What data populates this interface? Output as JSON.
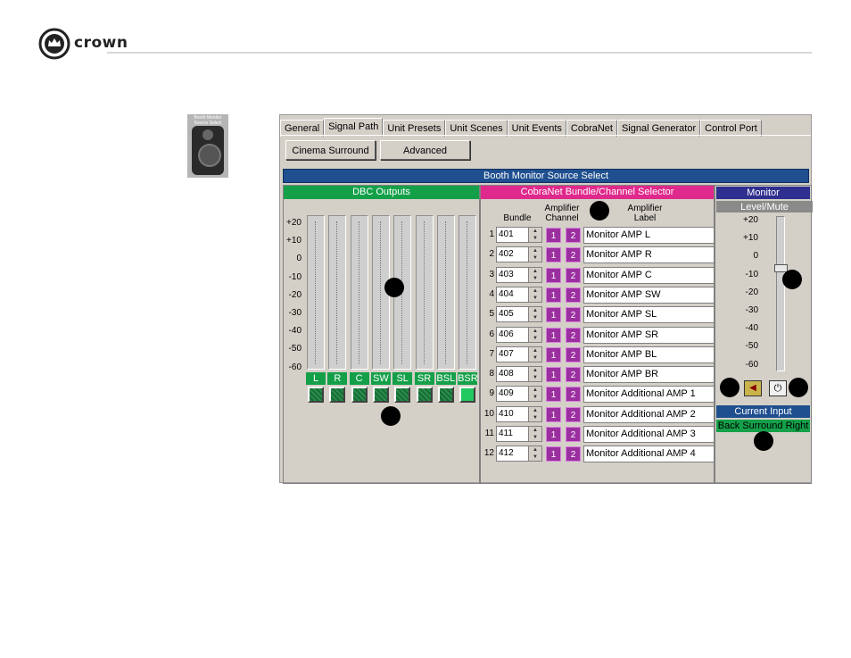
{
  "brand": {
    "name": "crown"
  },
  "thumbnail": {
    "caption": "Booth Monitor Source Select"
  },
  "tabs": [
    {
      "label": "General"
    },
    {
      "label": "Signal Path",
      "active": true
    },
    {
      "label": "Unit Presets"
    },
    {
      "label": "Unit Scenes"
    },
    {
      "label": "Unit Events"
    },
    {
      "label": "CobraNet"
    },
    {
      "label": "Signal Generator"
    },
    {
      "label": "Control Port"
    }
  ],
  "mode_buttons": {
    "cinema_surround": "Cinema Surround",
    "advanced": "Advanced"
  },
  "title_bar": "Booth Monitor Source Select",
  "dbc": {
    "title": "DBC Outputs",
    "scale": [
      "+20",
      "+10",
      "0",
      "-10",
      "-20",
      "-30",
      "-40",
      "-50",
      "-60"
    ],
    "channels": [
      "L",
      "R",
      "C",
      "SW",
      "SL",
      "SR",
      "BSL",
      "BSR"
    ],
    "selected_channel": "BSR"
  },
  "cobranet": {
    "title": "CobraNet Bundle/Channel Selector",
    "col_bundle": "Bundle",
    "col_channel": "Amplifier Channel",
    "col_label": "Amplifier Label",
    "rows": [
      {
        "n": "1",
        "bundle": "401",
        "label": "Monitor AMP L"
      },
      {
        "n": "2",
        "bundle": "402",
        "label": "Monitor AMP R"
      },
      {
        "n": "3",
        "bundle": "403",
        "label": "Monitor AMP C"
      },
      {
        "n": "4",
        "bundle": "404",
        "label": "Monitor AMP SW"
      },
      {
        "n": "5",
        "bundle": "405",
        "label": "Monitor AMP SL"
      },
      {
        "n": "6",
        "bundle": "406",
        "label": "Monitor AMP SR"
      },
      {
        "n": "7",
        "bundle": "407",
        "label": "Monitor AMP BL"
      },
      {
        "n": "8",
        "bundle": "408",
        "label": "Monitor AMP BR"
      },
      {
        "n": "9",
        "bundle": "409",
        "label": "Monitor Additional AMP 1"
      },
      {
        "n": "10",
        "bundle": "410",
        "label": "Monitor Additional AMP 2"
      },
      {
        "n": "11",
        "bundle": "411",
        "label": "Monitor Additional AMP 3"
      },
      {
        "n": "12",
        "bundle": "412",
        "label": "Monitor Additional AMP 4"
      }
    ],
    "ch1": "1",
    "ch2": "2"
  },
  "monitor": {
    "title": "Monitor",
    "level_mute": "Level/Mute",
    "scale": [
      "+20",
      "+10",
      "0",
      "-10",
      "-20",
      "-30",
      "-40",
      "-50",
      "-60"
    ],
    "level_db": -5,
    "current_input_title": "Current Input",
    "current_input_value": "Back Surround Right"
  },
  "colors": {
    "title_bar": "#1f4f8f",
    "dbc_header": "#14a049",
    "cobranet_header": "#e0298c",
    "monitor_header": "#2f2f8f",
    "current_input_value": "#14a049"
  }
}
